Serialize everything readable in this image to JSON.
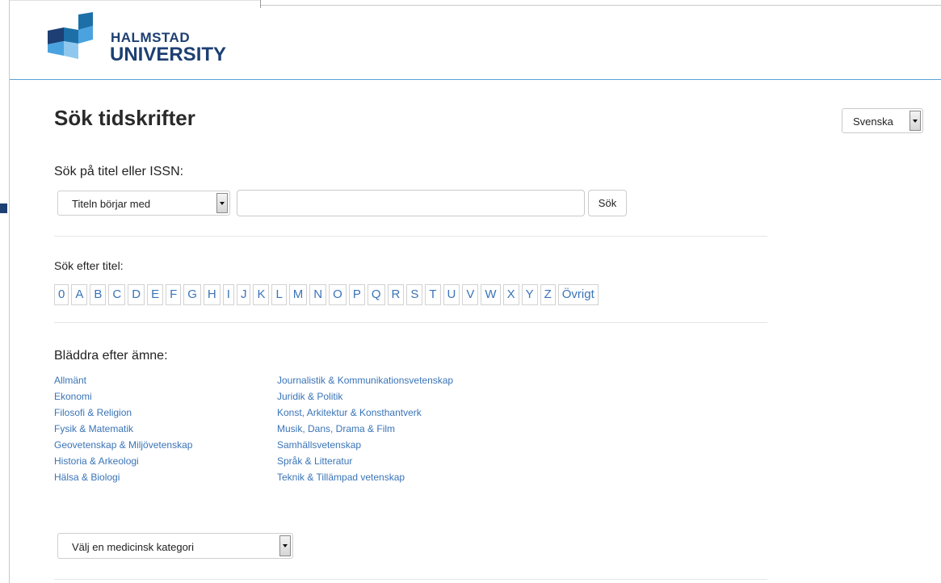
{
  "brand": {
    "name_line1": "HALMSTAD",
    "name_line2": "UNIVERSITY",
    "color_dark": "#1d3f73",
    "color_light": "#4aa3df"
  },
  "page_title": "Sök tidskrifter",
  "language_select": {
    "selected": "Svenska"
  },
  "search": {
    "label": "Sök på titel eller ISSN:",
    "mode_selected": "Titeln börjar med",
    "query_value": "",
    "button_label": "Sök"
  },
  "browse_title": {
    "label": "Sök efter titel:",
    "letters": [
      "0",
      "A",
      "B",
      "C",
      "D",
      "E",
      "F",
      "G",
      "H",
      "I",
      "J",
      "K",
      "L",
      "M",
      "N",
      "O",
      "P",
      "Q",
      "R",
      "S",
      "T",
      "U",
      "V",
      "W",
      "X",
      "Y",
      "Z",
      "Övrigt"
    ]
  },
  "subjects": {
    "label": "Bläddra efter ämne:",
    "column1": [
      "Allmänt",
      "Ekonomi",
      "Filosofi & Religion",
      "Fysik & Matematik",
      "Geovetenskap & Miljövetenskap",
      "Historia & Arkeologi",
      "Hälsa & Biologi"
    ],
    "column2": [
      "Journalistik & Kommunikationsvetenskap",
      "Juridik & Politik",
      "Konst, Arkitektur & Konsthantverk",
      "Musik, Dans, Drama & Film",
      "Samhällsvetenskap",
      "Språk & Litteratur",
      "Teknik & Tillämpad vetenskap"
    ]
  },
  "medical_select": {
    "selected": "Välj en medicinsk kategori"
  },
  "colors": {
    "link": "#3a74b7",
    "header_line": "#5aa3d6"
  }
}
